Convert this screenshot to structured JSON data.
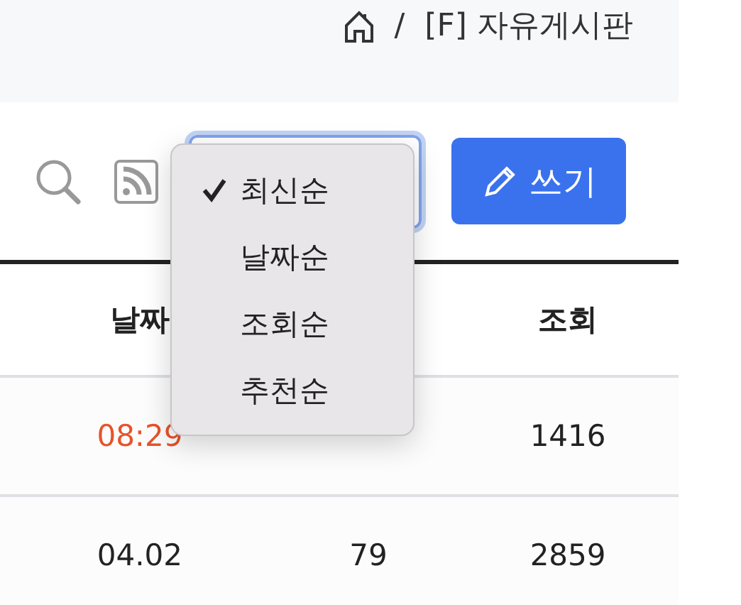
{
  "breadcrumb": {
    "separator": "/",
    "current": "[F] 자유게시판"
  },
  "toolbar": {
    "sort_select": {
      "expanded": true,
      "options": [
        {
          "label": "최신순",
          "selected": true
        },
        {
          "label": "날짜순",
          "selected": false
        },
        {
          "label": "조회순",
          "selected": false
        },
        {
          "label": "추천순",
          "selected": false
        }
      ]
    },
    "write_button": "쓰기"
  },
  "table": {
    "columns": {
      "date": "날짜",
      "views": "조회"
    },
    "rows": [
      {
        "date": "08:29",
        "highlighted": true,
        "views": "1416"
      },
      {
        "date": "04.02",
        "highlighted": false,
        "column_2": "79",
        "views": "2859"
      }
    ]
  }
}
